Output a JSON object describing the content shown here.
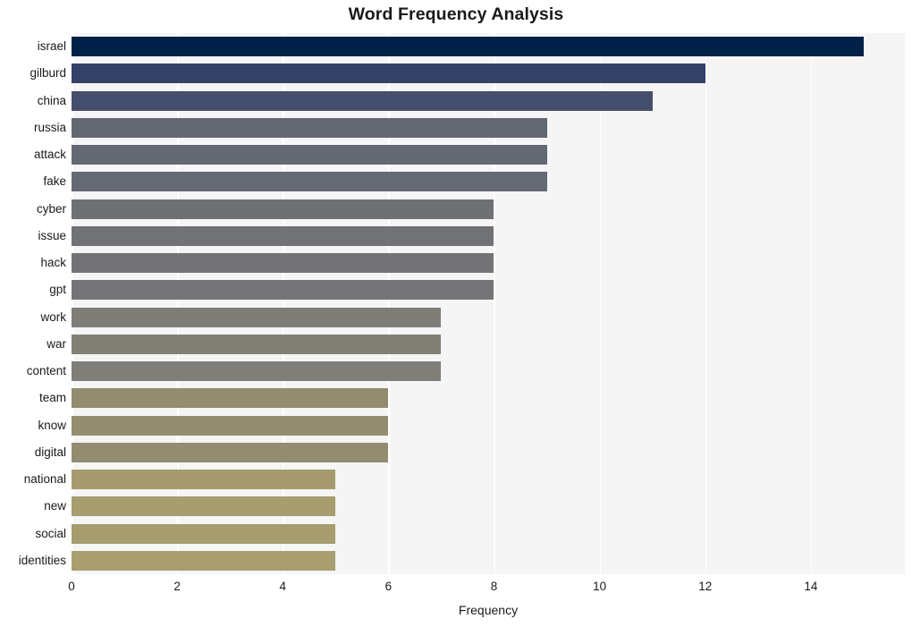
{
  "chart_data": {
    "type": "bar",
    "orientation": "horizontal",
    "title": "Word Frequency Analysis",
    "xlabel": "Frequency",
    "ylabel": "",
    "categories": [
      "israel",
      "gilburd",
      "china",
      "russia",
      "attack",
      "fake",
      "cyber",
      "issue",
      "hack",
      "gpt",
      "work",
      "war",
      "content",
      "team",
      "know",
      "digital",
      "national",
      "new",
      "social",
      "identities"
    ],
    "values": [
      15,
      12,
      11,
      9,
      9,
      9,
      8,
      8,
      8,
      8,
      7,
      7,
      7,
      6,
      6,
      6,
      5,
      5,
      5,
      5
    ],
    "bar_colors": [
      "#002147",
      "#344269",
      "#454f6d",
      "#63676f",
      "#636872",
      "#646973",
      "#6f7073",
      "#717275",
      "#737375",
      "#747476",
      "#7e7d77",
      "#827f77",
      "#7f7e78",
      "#938d6f",
      "#948e70",
      "#928c71",
      "#a59b6e",
      "#a79d6f",
      "#a69c6e",
      "#a89e70"
    ],
    "xlim": [
      0,
      15.78
    ],
    "xticks": [
      0,
      2,
      4,
      6,
      8,
      10,
      12,
      14
    ],
    "xtick_labels": [
      "0",
      "2",
      "4",
      "6",
      "8",
      "10",
      "12",
      "14"
    ],
    "grid": true,
    "grid_axis": "x",
    "grid_color": "#ffffff",
    "plot_background": "#f5f5f5",
    "figure_background": "#ffffff",
    "legend": null,
    "legend_position": "none",
    "series": [
      {
        "name": "Frequency",
        "values": [
          15,
          12,
          11,
          9,
          9,
          9,
          8,
          8,
          8,
          8,
          7,
          7,
          7,
          6,
          6,
          6,
          5,
          5,
          5,
          5
        ]
      }
    ]
  }
}
